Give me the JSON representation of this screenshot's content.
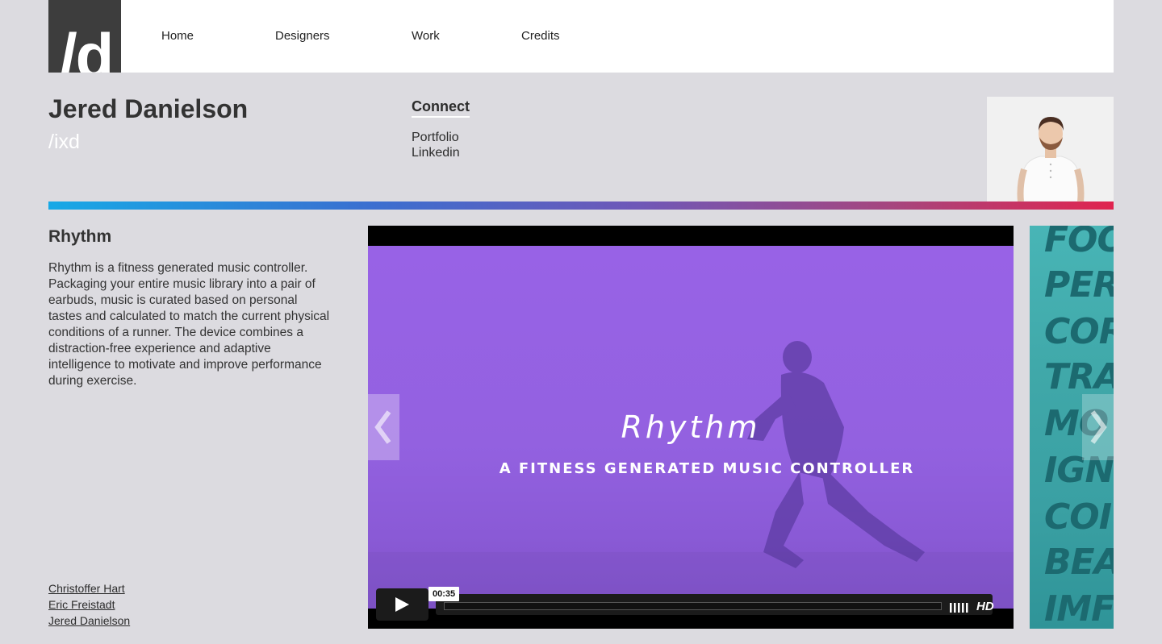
{
  "header": {
    "logo_text": "/d",
    "nav": [
      "Home",
      "Designers",
      "Work",
      "Credits"
    ]
  },
  "profile": {
    "name": "Jered Danielson",
    "discipline": "/ixd",
    "connect_title": "Connect",
    "links": [
      "Portfolio",
      "Linkedin"
    ]
  },
  "project": {
    "title": "Rhythm",
    "description": "Rhythm is a fitness generated music controller. Packaging your entire music library into a pair of earbuds, music is curated based on personal tastes and calculated to match the current physical conditions of a runner. The device combines a distraction-free experience and adaptive intelligence to motivate and improve performance during exercise.",
    "credits": [
      "Christoffer Hart",
      "Eric Freistadt",
      "Jered Danielson"
    ]
  },
  "video": {
    "title": "Rhythm",
    "subtitle": "A FITNESS GENERATED MUSIC CONTROLLER",
    "time": "00:35",
    "hd_label": "HD",
    "progress": 0
  },
  "next_slide": {
    "words": [
      "FOO",
      "PER",
      "COR",
      "TRA",
      "MO",
      "IGN",
      "COI",
      "BEA",
      "IMF"
    ]
  },
  "colors": {
    "page_bg": "#dcdbe0",
    "accent_gradient_start": "#17a9e6",
    "accent_gradient_end": "#e0244f",
    "video_purple": "#9862e6",
    "next_slide_teal": "#3aa9ab"
  },
  "icons": {
    "logo": "d-logo-icon",
    "play": "play-icon",
    "volume": "volume-bars-icon",
    "prev": "chevron-left-icon",
    "next": "chevron-right-icon"
  }
}
